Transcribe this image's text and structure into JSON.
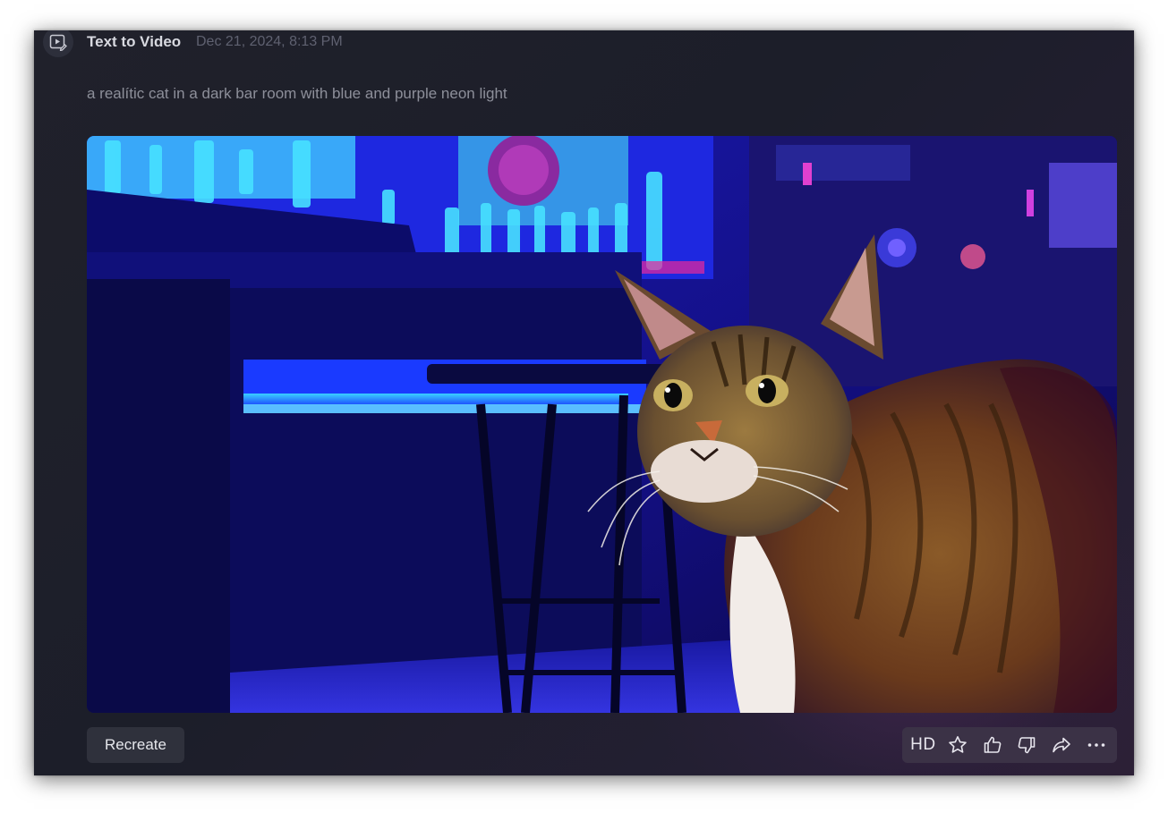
{
  "header": {
    "mode_icon": "video-edit-icon",
    "title": "Text to Video",
    "timestamp": "Dec 21, 2024, 8:13 PM"
  },
  "prompt": "a realític cat in a dark bar room with blue and purple neon light",
  "media": {
    "content": "cat-in-neon-bar-video-frame"
  },
  "footer": {
    "recreate_label": "Recreate",
    "actions": [
      {
        "label": "HD",
        "icon": "hd-text"
      },
      {
        "label": "",
        "icon": "star-icon"
      },
      {
        "label": "",
        "icon": "thumbs-up-icon"
      },
      {
        "label": "",
        "icon": "thumbs-down-icon"
      },
      {
        "label": "",
        "icon": "share-icon"
      },
      {
        "label": "",
        "icon": "more-icon"
      }
    ]
  },
  "colors": {
    "background": "#1e1f2a",
    "accent_glow": "#6e3278",
    "button_bg": "#2f313c",
    "toolbar_bg": "#3b3246",
    "text_primary": "#d8d9e0",
    "text_muted": "#5f6170"
  }
}
